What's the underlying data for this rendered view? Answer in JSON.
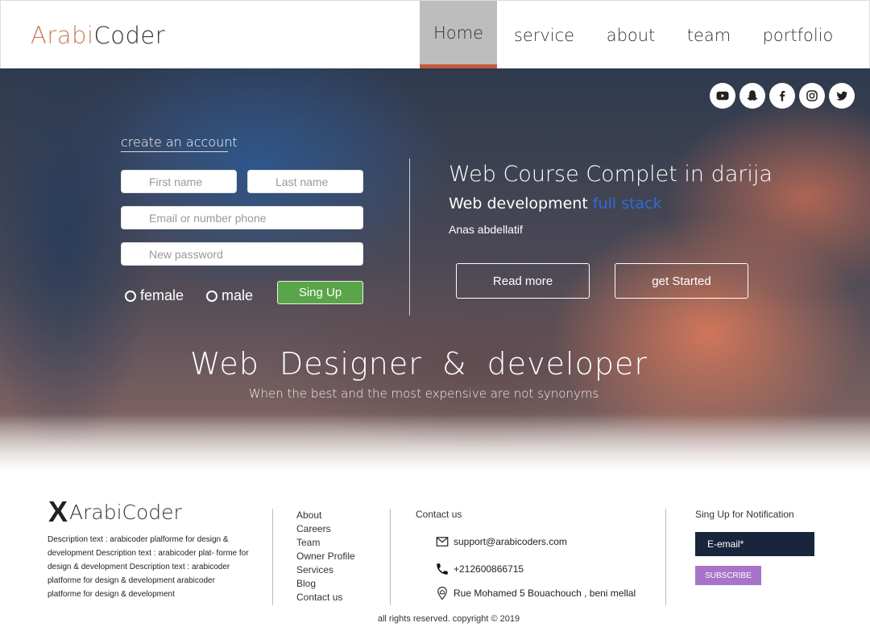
{
  "brand": {
    "part1": "Arabi",
    "part2": "Coder",
    "color1": "#c97a5a"
  },
  "nav": [
    "Home",
    "service",
    "about",
    "team",
    "portfolio"
  ],
  "social": [
    "youtube-icon",
    "snapchat-icon",
    "facebook-icon",
    "instagram-icon",
    "twitter-icon"
  ],
  "form": {
    "title": "create an account",
    "first_name": "First name",
    "last_name": "Last name",
    "email": "Email or number phone",
    "password": "New password",
    "female": "female",
    "male": "male",
    "submit": "Sing Up"
  },
  "course": {
    "title": "Web Course Complet in darija",
    "subtitle": "Web development",
    "highlight": "full stack",
    "author": "Anas abdellatif",
    "read_more": "Read more",
    "get_started": "get Started"
  },
  "headline": "Web Designer & developer",
  "tagline": "When the best and the most expensive are not synonyms",
  "footer": {
    "logo_mark": "X",
    "logo_text": "ArabiCoder",
    "description": "Description text : arabicoder plalforme for design & development Description text : arabicoder plat- forme for design & development Description text : arabicoder platforme for design & development arabicoder platforme for design & development",
    "links": [
      "About",
      "Careers",
      "Team",
      "Owner Profile",
      "Services",
      "Blog",
      "Contact us"
    ],
    "contact_title": "Contact us",
    "email": "support@arabicoders.com",
    "phone": "+212600866715",
    "address": "Rue Mohamed 5 Bouachouch , beni mellal",
    "notif_title": "Sing Up for Notification",
    "notif_placeholder": "E-email*",
    "subscribe": "SUBSCRIBE",
    "copyright": "all rights reserved. copyright © 2019"
  }
}
